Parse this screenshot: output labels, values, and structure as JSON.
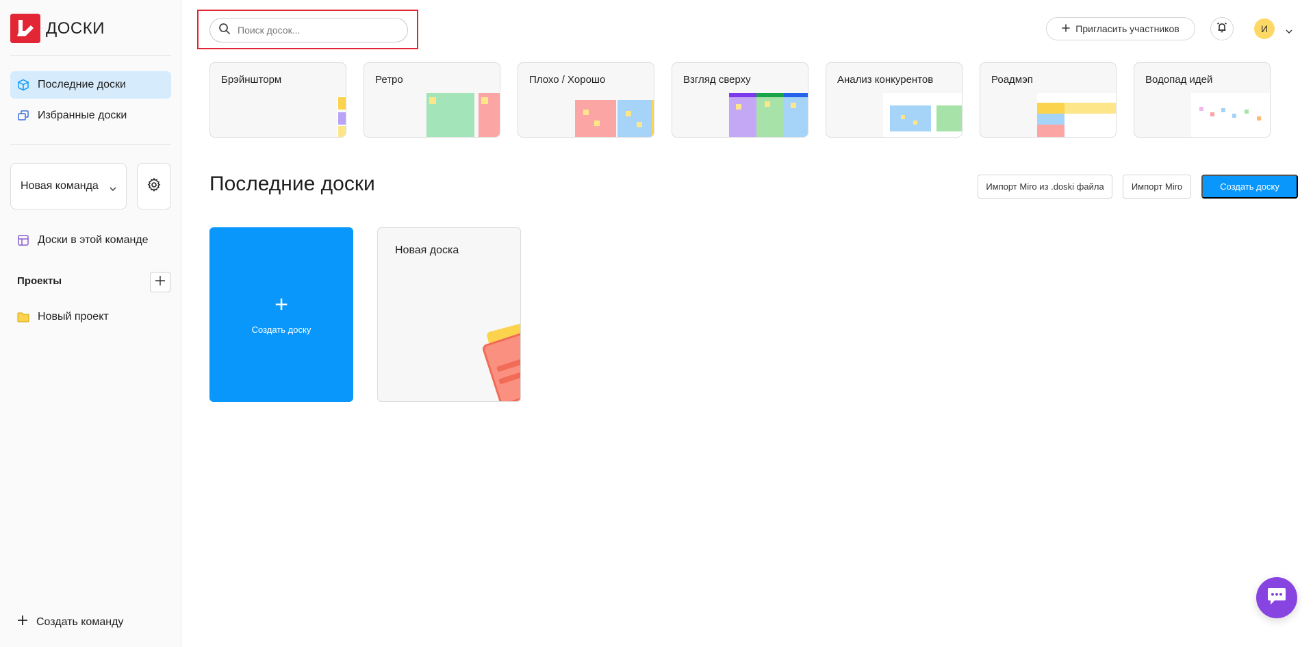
{
  "app": {
    "logo_text": "ДОСКИ"
  },
  "sidebar": {
    "nav": [
      {
        "label": "Последние доски",
        "active": true
      },
      {
        "label": "Избранные доски",
        "active": false
      }
    ],
    "team_select": {
      "value": "Новая команда"
    },
    "team_boards_label": "Доски в этой команде",
    "projects_title": "Проекты",
    "projects": [
      {
        "label": "Новый проект"
      }
    ],
    "create_team_label": "Создать команду"
  },
  "header": {
    "search_placeholder": "Поиск досок...",
    "invite_label": "Пригласить участников",
    "avatar_initial": "И"
  },
  "templates": [
    {
      "title": "Брэйншторм"
    },
    {
      "title": "Ретро"
    },
    {
      "title": "Плохо / Хорошо"
    },
    {
      "title": "Взгляд сверху"
    },
    {
      "title": "Анализ конкурентов"
    },
    {
      "title": "Роадмэп"
    },
    {
      "title": "Водопад идей"
    }
  ],
  "recent": {
    "title": "Последние доски",
    "import_doski_label": "Импорт Miro из .doski файла",
    "import_miro_label": "Импорт Miro",
    "create_board_label": "Создать доску",
    "create_card_label": "Создать доску",
    "boards": [
      {
        "title": "Новая доска"
      }
    ]
  },
  "colors": {
    "accent_blue": "#0a97fb",
    "brand_red": "#e32636",
    "chat_purple": "#8844e0",
    "active_nav": "#d6ecfd"
  }
}
